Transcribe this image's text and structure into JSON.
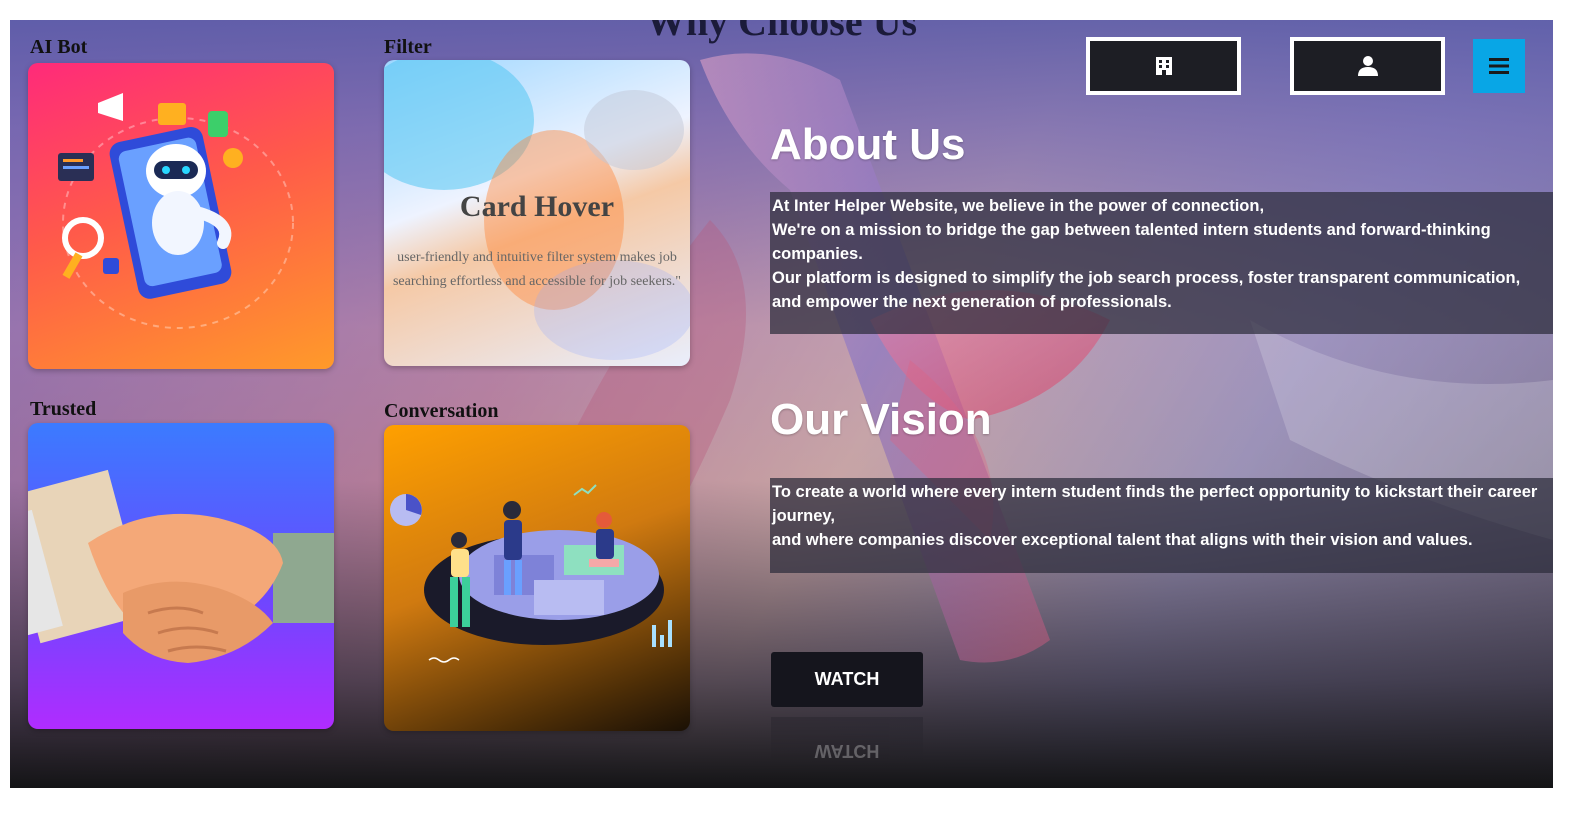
{
  "page": {
    "heading": "Why Choose Us"
  },
  "cards": {
    "ai_bot": {
      "label": "AI Bot"
    },
    "filter": {
      "label": "Filter",
      "hover_title": "Card Hover",
      "hover_text": "user-friendly and intuitive filter system makes job searching effortless and accessible for job seekers.\""
    },
    "trusted": {
      "label": "Trusted"
    },
    "conversation": {
      "label": "Conversation"
    }
  },
  "header": {
    "buttons": [
      {
        "icon": "building-icon"
      },
      {
        "icon": "user-icon"
      },
      {
        "icon": "hamburger-menu-icon"
      }
    ]
  },
  "about": {
    "title": "About Us",
    "lines": [
      "At Inter Helper Website, we believe in the power of connection,",
      "We're on a mission to bridge the gap between talented intern students and forward-thinking companies.",
      "Our platform is designed to simplify the job search process, foster transparent communication,",
      "and empower the next generation of professionals."
    ]
  },
  "vision": {
    "title": "Our Vision",
    "lines": [
      "To create a world where every intern student finds the perfect opportunity to kickstart their career journey,",
      "and where companies discover exceptional talent that aligns with their vision and values."
    ]
  },
  "cta": {
    "watch_label": "WATCH"
  },
  "colors": {
    "menu_button": "#08a6e6",
    "dark_button": "#1d1e24",
    "text_box_bg": "rgba(45,45,60,0.72)"
  }
}
